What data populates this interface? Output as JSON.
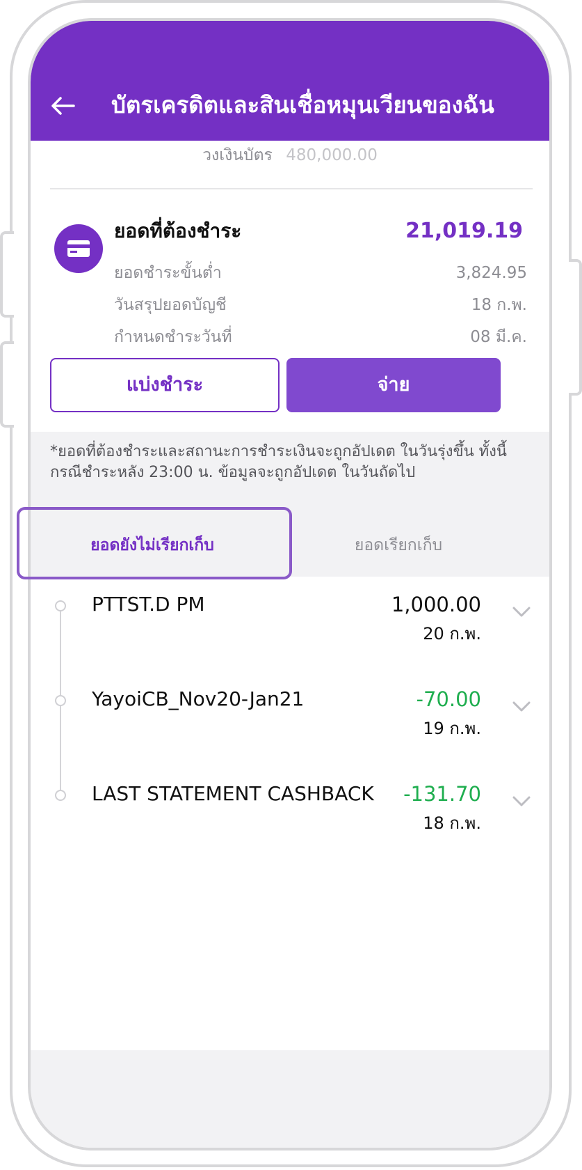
{
  "header": {
    "title": "บัตรเครดิตและสินเชื่อหมุนเวียนของฉัน",
    "background_color": "#7430c4"
  },
  "credit_limit": {
    "label": "วงเงินบัตร",
    "value": "480,000.00"
  },
  "amount_due": {
    "title": "ยอดที่ต้องชำระ",
    "amount": "21,019.19",
    "icon": "credit-card-icon",
    "rows": [
      {
        "label": "ยอดชำระขั้นต่ำ",
        "value": "3,824.95"
      },
      {
        "label": "วันสรุปยอดบัญชี",
        "value": "18 ก.พ."
      },
      {
        "label": "กำหนดชำระวันที่",
        "value": "08 มี.ค."
      }
    ]
  },
  "buttons": {
    "split_label": "แบ่งชำระ",
    "pay_label": "จ่าย"
  },
  "note": {
    "text": "*ยอดที่ต้องชำระและสถานะการชำระเงินจะถูกอัปเดต ในวันรุ่งขึ้น ทั้งนี้กรณีชำระหลัง 23:00 น. ข้อมูลจะถูกอัปเดต ในวันถัดไป"
  },
  "tabs": [
    {
      "label": "ยอดยังไม่เรียกเก็บ",
      "active": true
    },
    {
      "label": "ยอดเรียกเก็บ",
      "active": false
    }
  ],
  "transactions": [
    {
      "name": "PTTST.D PM",
      "amount": "1,000.00",
      "date": "20 ก.พ.",
      "amount_color": "#111111"
    },
    {
      "name": "YayoiCB_Nov20-Jan21",
      "amount": "-70.00",
      "date": "19 ก.พ.",
      "amount_color": "#1fae4f"
    },
    {
      "name": "LAST STATEMENT CASHBACK",
      "amount": "-131.70",
      "date": "18 ก.พ.",
      "amount_color": "#1fae4f"
    }
  ],
  "colors": {
    "accent": "#7430c4",
    "positive_credit": "#1fae4f",
    "muted_text": "#8d8d93"
  }
}
